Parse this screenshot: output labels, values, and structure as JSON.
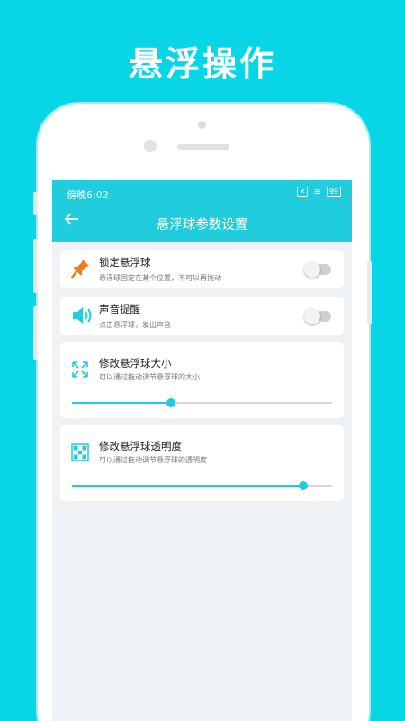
{
  "promo": {
    "title": "悬浮操作"
  },
  "status": {
    "time": "傍晚6:02",
    "battery": "99"
  },
  "appbar": {
    "title": "悬浮球参数设置",
    "back_icon": "back-arrow-icon"
  },
  "settings": [
    {
      "title": "锁定悬浮球",
      "desc": "悬浮球固定在某个位置，不可以再拖动",
      "icon": "pin-icon",
      "enabled": false
    },
    {
      "title": "声音提醒",
      "desc": "点击悬浮球，发出声音",
      "icon": "speaker-icon",
      "enabled": false
    },
    {
      "title": "修改悬浮球大小",
      "desc": "可以通过拖动调节悬浮球的大小",
      "icon": "resize-icon",
      "level": 0.38
    },
    {
      "title": "修改悬浮球透明度",
      "desc": "可以通过拖动调节悬浮球的透明度",
      "icon": "transparency-icon",
      "level": 0.89
    }
  ],
  "colors": {
    "accent": "#21ccdc",
    "background": "#08d6e6",
    "pin": "#f07d24"
  }
}
